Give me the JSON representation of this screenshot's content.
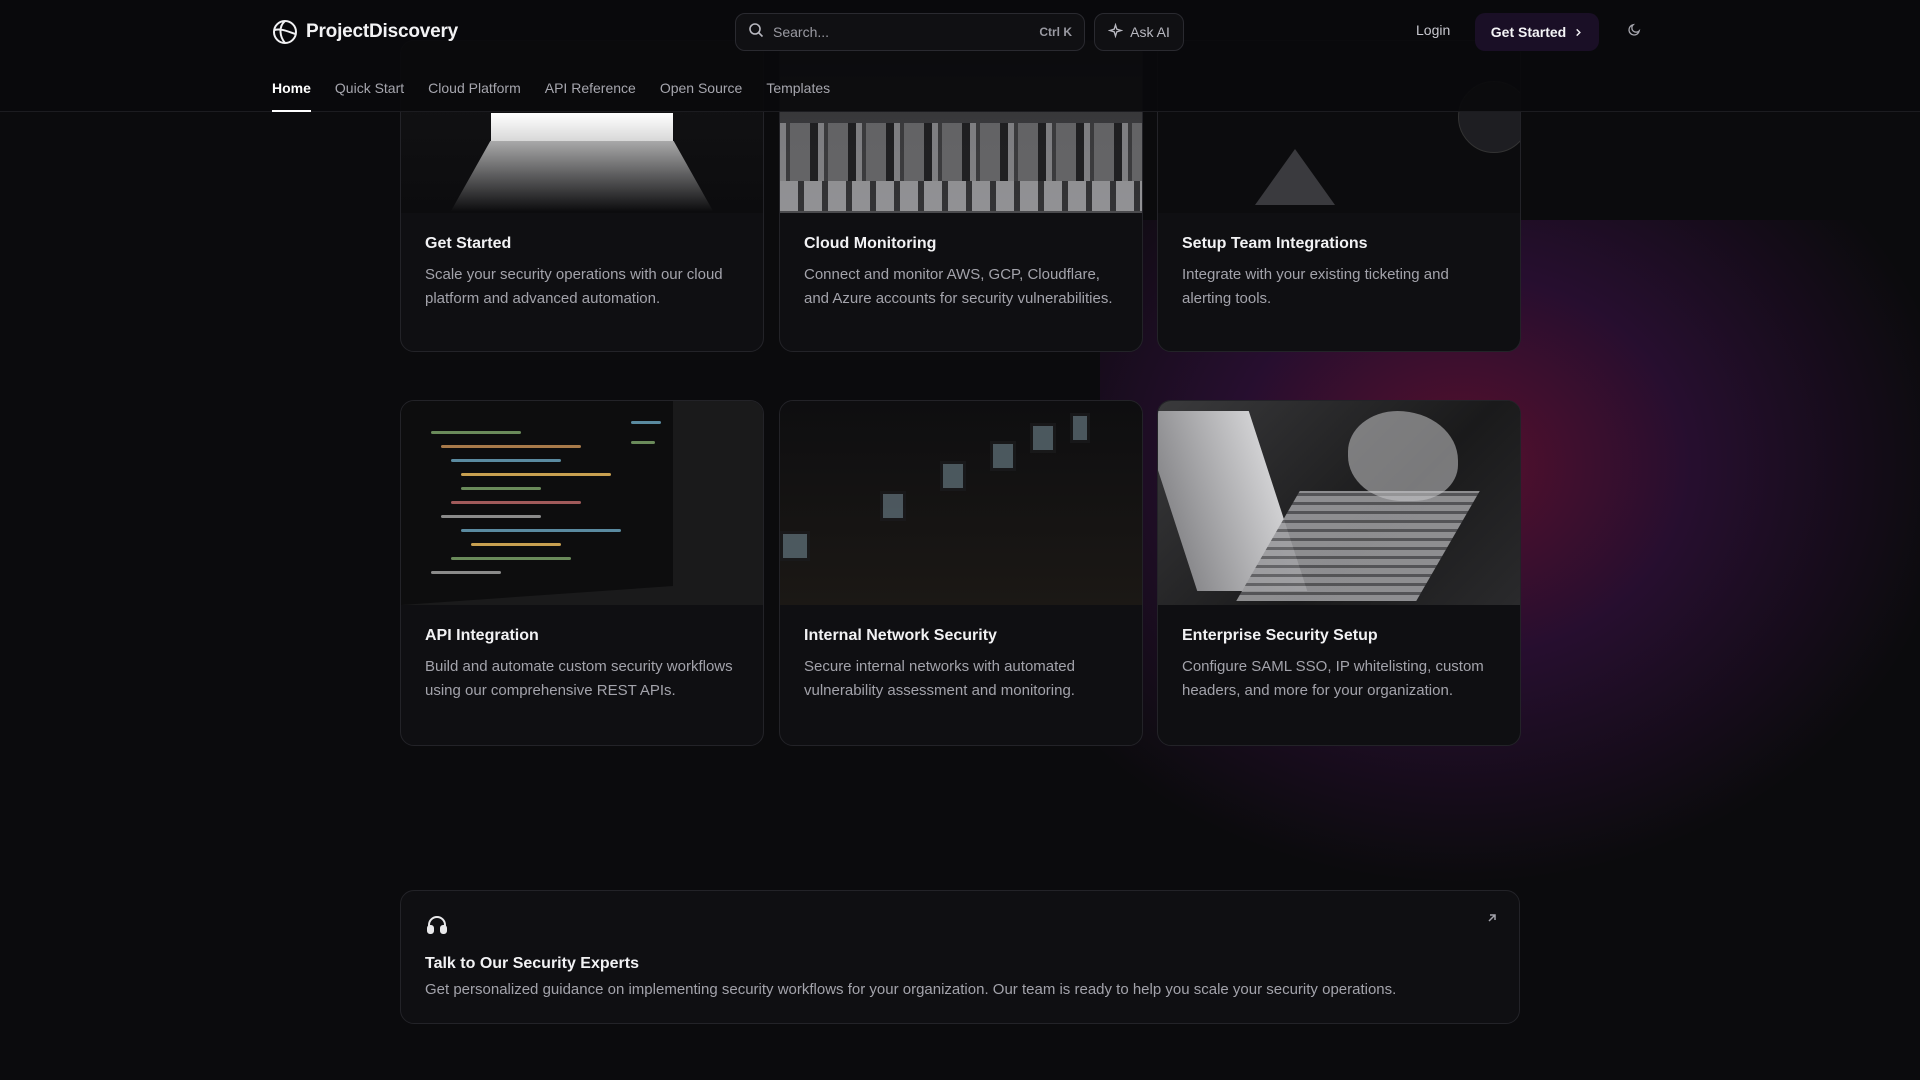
{
  "header": {
    "brand": "ProjectDiscovery",
    "search": {
      "placeholder": "Search...",
      "shortcut": "Ctrl K"
    },
    "ask_ai_label": "Ask AI",
    "login_label": "Login",
    "get_started_label": "Get Started",
    "theme_icon": "moon-icon"
  },
  "nav": {
    "tabs": [
      {
        "label": "Home",
        "active": true
      },
      {
        "label": "Quick Start",
        "active": false
      },
      {
        "label": "Cloud Platform",
        "active": false
      },
      {
        "label": "API Reference",
        "active": false
      },
      {
        "label": "Open Source",
        "active": false
      },
      {
        "label": "Templates",
        "active": false
      }
    ]
  },
  "cards": [
    {
      "title": "Get Started",
      "description": "Scale your security operations with our cloud platform and advanced automation."
    },
    {
      "title": "Cloud Monitoring",
      "description": "Connect and monitor AWS, GCP, Cloudflare, and Azure accounts for security vulnerabilities."
    },
    {
      "title": "Setup Team Integrations",
      "description": "Integrate with your existing ticketing and alerting tools."
    },
    {
      "title": "API Integration",
      "description": "Build and automate custom security workflows using our comprehensive REST APIs."
    },
    {
      "title": "Internal Network Security",
      "description": "Secure internal networks with automated vulnerability assessment and monitoring."
    },
    {
      "title": "Enterprise Security Setup",
      "description": "Configure SAML SSO, IP whitelisting, custom headers, and more for your organization."
    }
  ],
  "contact": {
    "icon": "headset-icon",
    "title": "Talk to Our Security Experts",
    "description": "Get personalized guidance on implementing security workflows for your organization. Our team is ready to help you scale your security operations."
  },
  "colors": {
    "background": "#0b0b0d",
    "card_background": "#0f0f12",
    "border": "#232328",
    "accent_glow": "#96144a",
    "get_started_bg": "#1a0f26"
  }
}
